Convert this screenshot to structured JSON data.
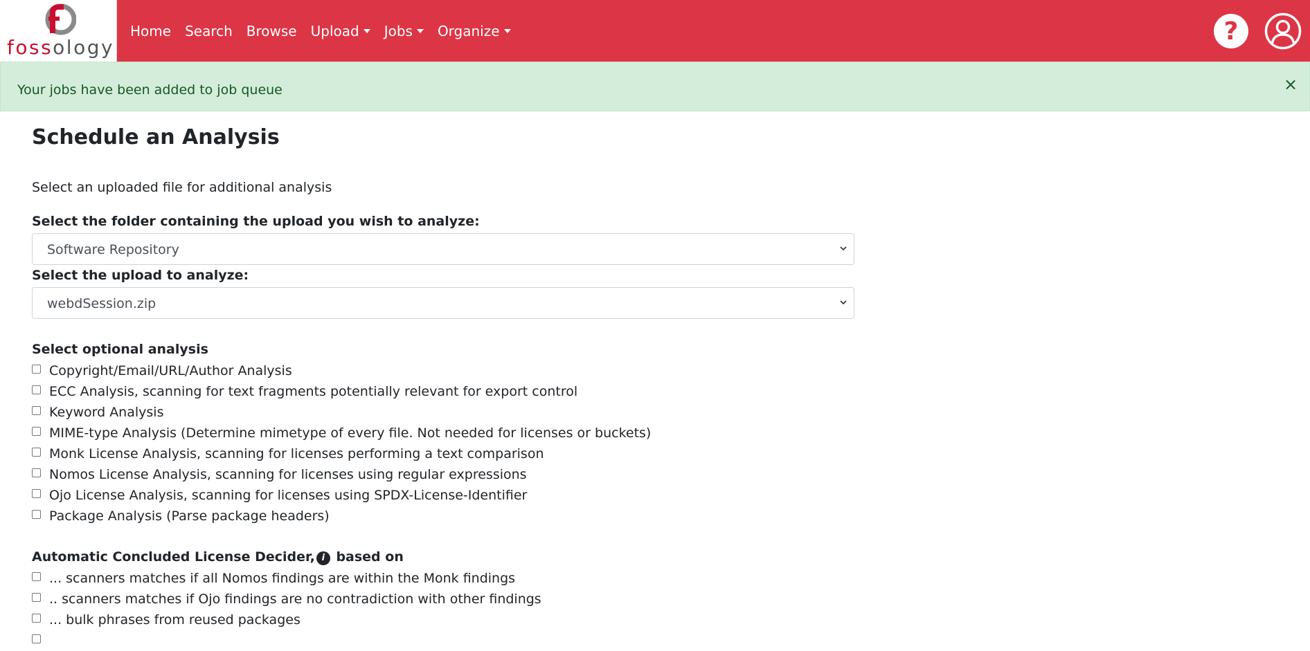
{
  "brand": {
    "logo_text_red": "foss",
    "logo_text_gray": "ology",
    "logo_icon": "fossology-logo-icon"
  },
  "nav": {
    "items": [
      {
        "label": "Home",
        "dropdown": false
      },
      {
        "label": "Search",
        "dropdown": false
      },
      {
        "label": "Browse",
        "dropdown": false
      },
      {
        "label": "Upload",
        "dropdown": true
      },
      {
        "label": "Jobs",
        "dropdown": true
      },
      {
        "label": "Organize",
        "dropdown": true
      }
    ],
    "help_icon": "question-mark-icon",
    "help_glyph": "?",
    "user_icon": "user-avatar-icon"
  },
  "alert": {
    "message": "Your jobs have been added to job queue",
    "close_glyph": "×"
  },
  "page": {
    "title": "Schedule an Analysis",
    "intro": "Select an uploaded file for additional analysis",
    "folder_label": "Select the folder containing the upload you wish to analyze:",
    "folder_value": "Software Repository",
    "upload_label": "Select the upload to analyze:",
    "upload_value": "webdSession.zip",
    "optional_heading": "Select optional analysis",
    "optional_items": [
      "Copyright/Email/URL/Author Analysis",
      "ECC Analysis, scanning for text fragments potentially relevant for export control",
      "Keyword Analysis",
      "MIME-type Analysis (Determine mimetype of every file. Not needed for licenses or buckets)",
      "Monk License Analysis, scanning for licenses performing a text comparison",
      "Nomos License Analysis, scanning for licenses using regular expressions",
      "Ojo License Analysis, scanning for licenses using SPDX-License-Identifier",
      "Package Analysis (Parse package headers)"
    ],
    "decider_heading_pre": "Automatic Concluded License Decider,",
    "decider_info_glyph": "i",
    "decider_heading_post": "based on",
    "decider_items": [
      "... scanners matches if all Nomos findings are within the Monk findings",
      ".. scanners matches if Ojo findings are no contradiction with other findings",
      "... bulk phrases from reused packages"
    ]
  },
  "colors": {
    "navbar": "#dc3545",
    "alert_bg": "#d4edda",
    "alert_text": "#155724"
  }
}
